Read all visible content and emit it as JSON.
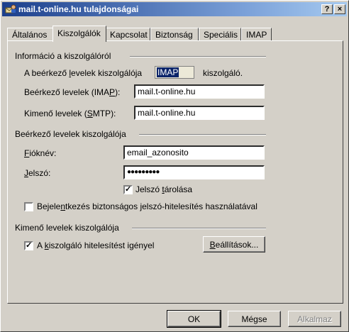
{
  "window": {
    "title": "mail.t-online.hu tulajdonságai",
    "help_label": "?",
    "close_label": "×"
  },
  "tabs": [
    "Általános",
    "Kiszolgálók",
    "Kapcsolat",
    "Biztonság",
    "Speciális",
    "IMAP"
  ],
  "server_info": {
    "group_title": "Információ a kiszolgálóról",
    "incoming_type_prefix": "A beérkező ",
    "incoming_type_u": "l",
    "incoming_type_suffix": "evelek kiszolgálója",
    "incoming_type_value": "IMAP",
    "incoming_type_after": "kiszolgáló.",
    "imap_label_prefix": "Beérkező levelek (IMA",
    "imap_label_u": "P",
    "imap_label_suffix": "):",
    "imap_value": "mail.t-online.hu",
    "smtp_label_prefix": "Kimenő levelek (",
    "smtp_label_u": "S",
    "smtp_label_suffix": "MTP):",
    "smtp_value": "mail.t-online.hu"
  },
  "incoming_server": {
    "group_title": "Beérkező levelek kiszolgálója",
    "account_label_u": "F",
    "account_label_rest": "ióknév:",
    "account_value": "email_azonosito",
    "password_label_u": "J",
    "password_label_rest": "elszó:",
    "password_value": "●●●●●●●●●",
    "remember_prefix": "Jelszó ",
    "remember_u": "t",
    "remember_suffix": "árolása",
    "remember_checked": true,
    "spa_prefix": "Bejele",
    "spa_u": "n",
    "spa_suffix": "tkezés biztonságos jelszó-hitelesítés használatával",
    "spa_checked": false
  },
  "outgoing_server": {
    "group_title": "Kimenő levelek kiszolgálója",
    "auth_prefix": "A ",
    "auth_u": "k",
    "auth_suffix": "iszolgáló hitelesítést igényel",
    "auth_checked": true,
    "settings_u": "B",
    "settings_rest": "eállítások..."
  },
  "buttons": {
    "ok": "OK",
    "cancel": "Mégse",
    "apply": "Alkalmaz"
  },
  "colors": {
    "face": "#d4d0c8",
    "title_start": "#1c3f8c",
    "title_end": "#a6caf0",
    "selection": "#0a246a"
  }
}
